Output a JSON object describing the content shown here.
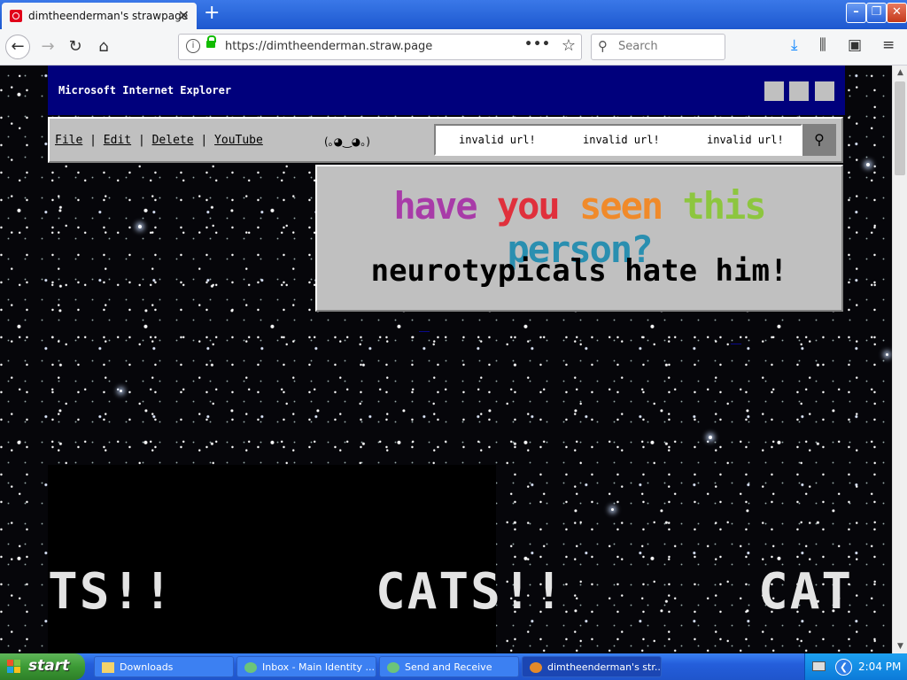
{
  "browser": {
    "tab_title": "dimtheenderman's strawpage",
    "url": "https://dimtheenderman.straw.page",
    "search_placeholder": "Search"
  },
  "page": {
    "ie_title": "Microsoft Internet Explorer",
    "menu": [
      "File",
      "Edit",
      "Delete",
      "YouTube"
    ],
    "menu_separator": "|",
    "face": "(｡◕‿◕｡)",
    "links": [
      "invalid url!",
      "invalid url!",
      "invalid url!"
    ],
    "headline_words": [
      "have",
      "you",
      "seen",
      "this",
      "person?"
    ],
    "subheadline": "neurotypicals hate him!",
    "cats_text": [
      "TS!!",
      "CATS!!",
      "CAT"
    ]
  },
  "colors": {
    "ie_titlebar": "#00007c",
    "win_gray": "#c0c0c0",
    "rainbow": [
      "#a83ba8",
      "#e0303c",
      "#f08a2a",
      "#8dc63f",
      "#2a8fb0"
    ]
  },
  "taskbar": {
    "start_label": "start",
    "tasks": [
      "Downloads",
      "Inbox - Main Identity ...",
      "Send and Receive",
      "dimtheenderman's str..."
    ],
    "clock": "2:04 PM"
  }
}
